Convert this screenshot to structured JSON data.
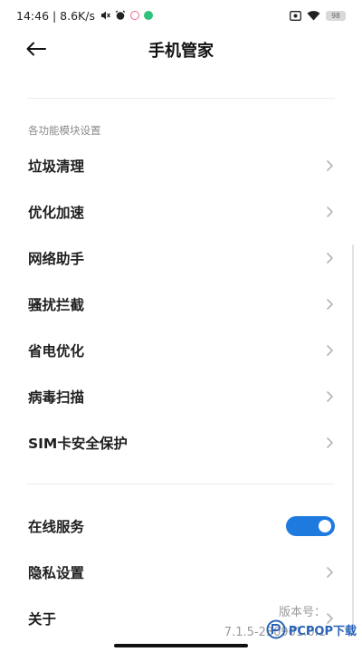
{
  "statusbar": {
    "time_speed": "14:46 | 8.6K/s",
    "battery": "98"
  },
  "header": {
    "title": "手机管家",
    "back_icon": "arrow-left-icon"
  },
  "section": {
    "label": "各功能模块设置",
    "items": [
      {
        "label": "垃圾清理"
      },
      {
        "label": "优化加速"
      },
      {
        "label": "网络助手"
      },
      {
        "label": "骚扰拦截"
      },
      {
        "label": "省电优化"
      },
      {
        "label": "病毒扫描"
      },
      {
        "label": "SIM卡安全保护"
      }
    ]
  },
  "general": {
    "online_service": {
      "label": "在线服务",
      "enabled": true
    },
    "privacy": {
      "label": "隐私设置"
    },
    "about": {
      "label": "关于"
    }
  },
  "version": {
    "label": "版本号：",
    "value": "7.1.5-230901.0.1"
  },
  "watermark": {
    "text": "PCPOP下载"
  },
  "colors": {
    "accent": "#1f7ae0",
    "label_gray": "#8c8c8c",
    "divider": "#ececec"
  }
}
